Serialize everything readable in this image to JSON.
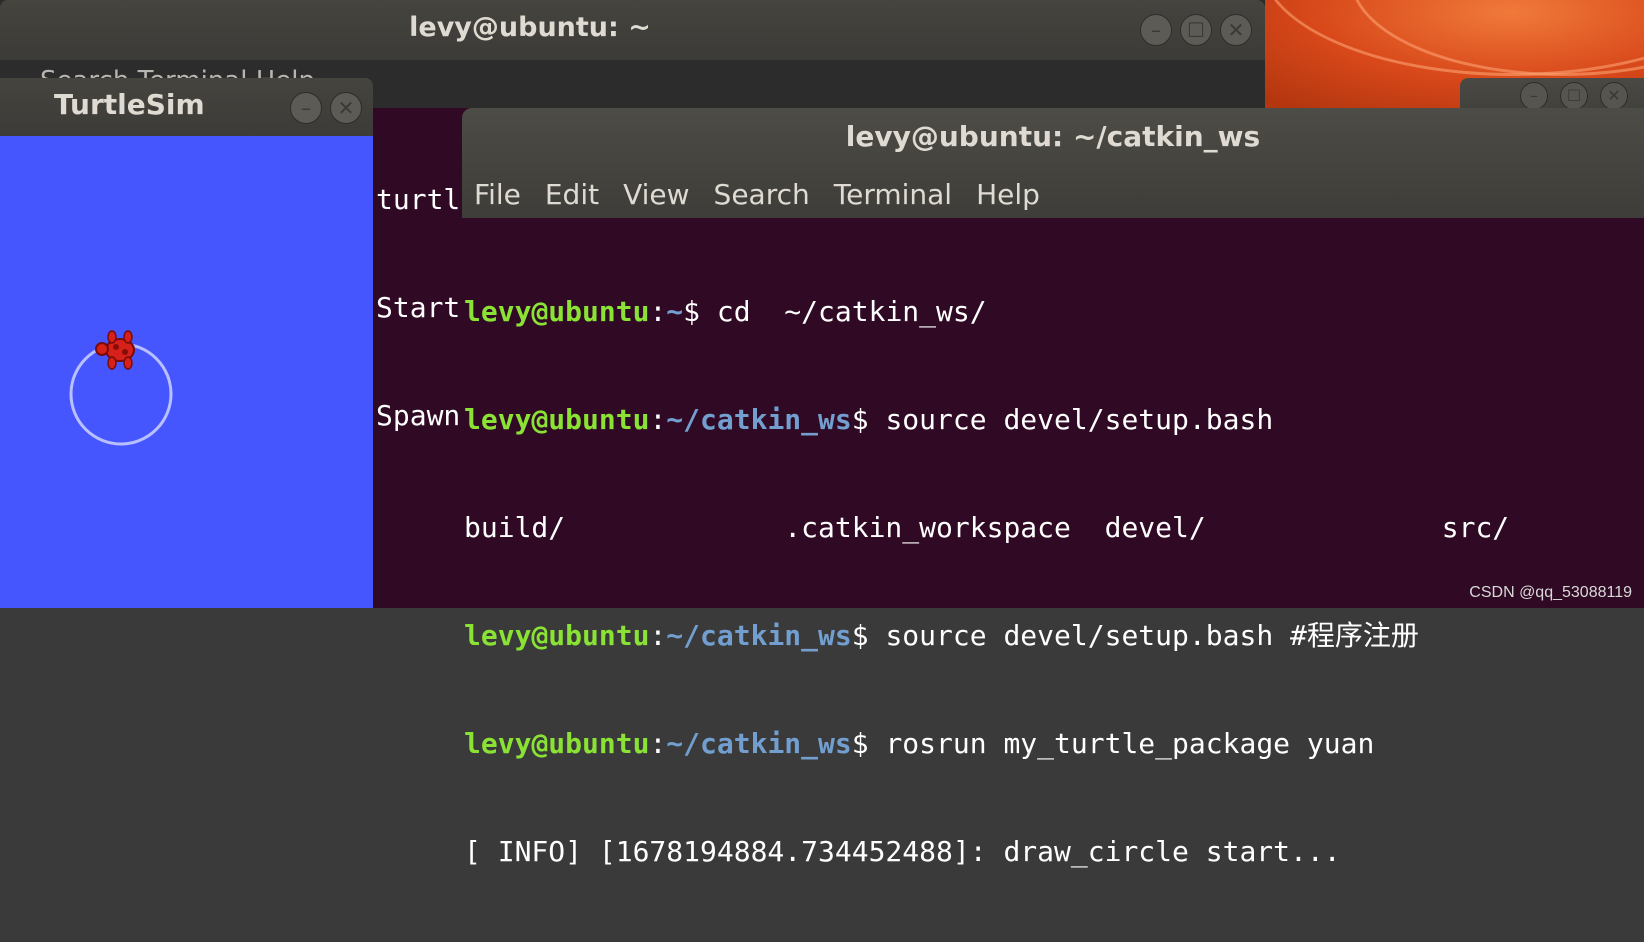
{
  "back_terminal": {
    "title": "levy@ubuntu: ~",
    "menu_ghost": "Search  Terminal  Help",
    "lines": [
      "turtl",
      "Start",
      "Spawn"
    ]
  },
  "turtlesim": {
    "title": "TurtleSim",
    "background_color": "#4556ff"
  },
  "front_terminal": {
    "title": "levy@ubuntu: ~/catkin_ws",
    "menu": [
      "File",
      "Edit",
      "View",
      "Search",
      "Terminal",
      "Help"
    ],
    "lines": [
      {
        "user": "levy@ubuntu",
        "sep": ":",
        "path": "~",
        "cmd": "$ cd  ~/catkin_ws/"
      },
      {
        "user": "levy@ubuntu",
        "sep": ":",
        "path": "~/catkin_ws",
        "cmd": "$ source devel/setup.bash"
      },
      {
        "text": "build/             .catkin_workspace  devel/              src/"
      },
      {
        "user": "levy@ubuntu",
        "sep": ":",
        "path": "~/catkin_ws",
        "cmd": "$ source devel/setup.bash #程序注册"
      },
      {
        "user": "levy@ubuntu",
        "sep": ":",
        "path": "~/catkin_ws",
        "cmd": "$ rosrun my_turtle_package yuan"
      },
      {
        "text": "[ INFO] [1678194884.734452488]: draw_circle start..."
      }
    ]
  },
  "window_controls": {
    "minimize": "–",
    "maximize": "☐",
    "close": "✕"
  },
  "watermark": "CSDN @qq_53088119",
  "colors": {
    "terminal_bg": "#300a24",
    "prompt_user": "#8ae234",
    "prompt_path": "#729fcf",
    "titlebar": "#45443f"
  }
}
